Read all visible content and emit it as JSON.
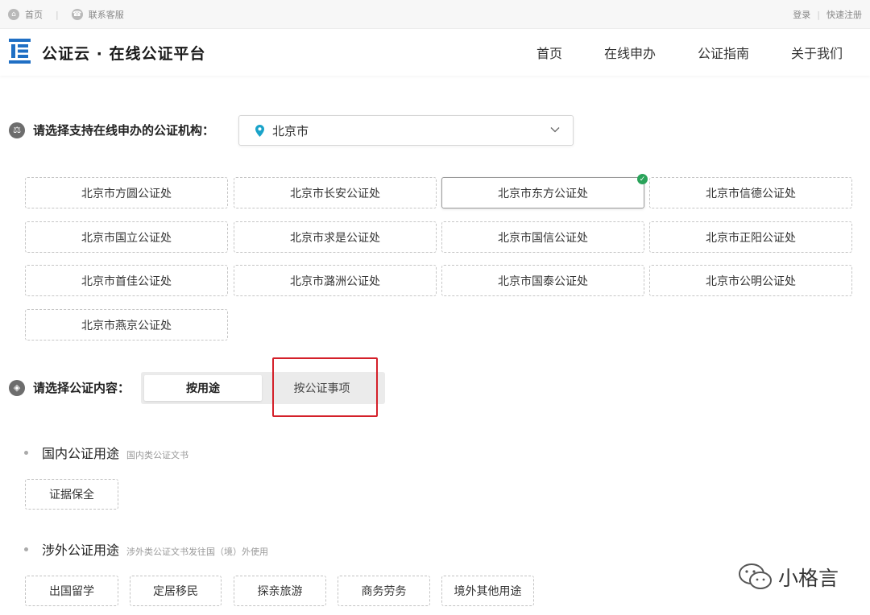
{
  "topbar": {
    "home": "首页",
    "service": "联系客服",
    "login": "登录",
    "register": "快速注册"
  },
  "header": {
    "brand": "公证云 · 在线公证平台",
    "nav": [
      "首页",
      "在线申办",
      "公证指南",
      "关于我们"
    ]
  },
  "institution": {
    "label": "请选择支持在线申办的公证机构：",
    "city": "北京市",
    "offices": [
      "北京市方圆公证处",
      "北京市长安公证处",
      "北京市东方公证处",
      "北京市信德公证处",
      "北京市国立公证处",
      "北京市求是公证处",
      "北京市国信公证处",
      "北京市正阳公证处",
      "北京市首佳公证处",
      "北京市潞洲公证处",
      "北京市国泰公证处",
      "北京市公明公证处",
      "北京市燕京公证处"
    ],
    "selected_index": 2
  },
  "content": {
    "label": "请选择公证内容：",
    "tab_by_use": "按用途",
    "tab_by_matter": "按公证事项"
  },
  "domestic": {
    "title": "国内公证用途",
    "subtitle": "国内类公证文书",
    "chips": [
      "证据保全"
    ]
  },
  "foreign": {
    "title": "涉外公证用途",
    "subtitle": "涉外类公证文书发往国（境）外使用",
    "chips": [
      "出国留学",
      "定居移民",
      "探亲旅游",
      "商务劳务",
      "境外其他用途"
    ]
  },
  "watermark": "小格言",
  "colors": {
    "highlight": "#d4202a",
    "logo": "#1f6fc4",
    "check": "#2aa35a"
  }
}
